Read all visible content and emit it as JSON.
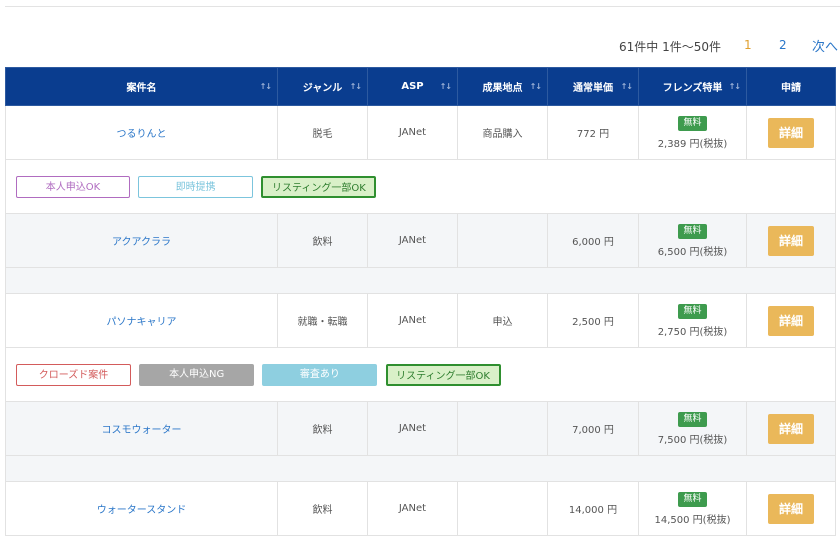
{
  "pager": {
    "count": "61件中 1件〜50件",
    "page1": "1",
    "page2": "2",
    "next": "次へ"
  },
  "headers": {
    "name": "案件名",
    "genre": "ジャンル",
    "asp": "ASP",
    "point": "成果地点",
    "price": "通常単価",
    "friends": "フレンズ特単",
    "apply": "申請",
    "sort_icon": "↑↓"
  },
  "rows": [
    {
      "name": "つるりんと",
      "genre": "脱毛",
      "asp": "JANet",
      "point": "商品購入",
      "price": "772 円",
      "badge": "無料",
      "tokutan": "2,389 円(税抜)",
      "detail": "詳細",
      "tags": [
        "本人申込OK",
        "即時提携",
        "リスティング一部OK"
      ]
    },
    {
      "name": "アクアクララ",
      "genre": "飲料",
      "asp": "JANet",
      "point": "",
      "price": "6,000 円",
      "badge": "無料",
      "tokutan": "6,500 円(税抜)",
      "detail": "詳細",
      "tags": []
    },
    {
      "name": "パソナキャリア",
      "genre": "就職・転職",
      "asp": "JANet",
      "point": "申込",
      "price": "2,500 円",
      "badge": "無料",
      "tokutan": "2,750 円(税抜)",
      "detail": "詳細",
      "tags": [
        "クローズド案件",
        "本人申込NG",
        "審査あり",
        "リスティング一部OK"
      ]
    },
    {
      "name": "コスモウォーター",
      "genre": "飲料",
      "asp": "JANet",
      "point": "",
      "price": "7,000 円",
      "badge": "無料",
      "tokutan": "7,500 円(税抜)",
      "detail": "詳細",
      "tags": []
    },
    {
      "name": "ウォータースタンド",
      "genre": "飲料",
      "asp": "JANet",
      "point": "",
      "price": "14,000 円",
      "badge": "無料",
      "tokutan": "14,500 円(税抜)",
      "detail": "詳細",
      "tags": []
    }
  ]
}
